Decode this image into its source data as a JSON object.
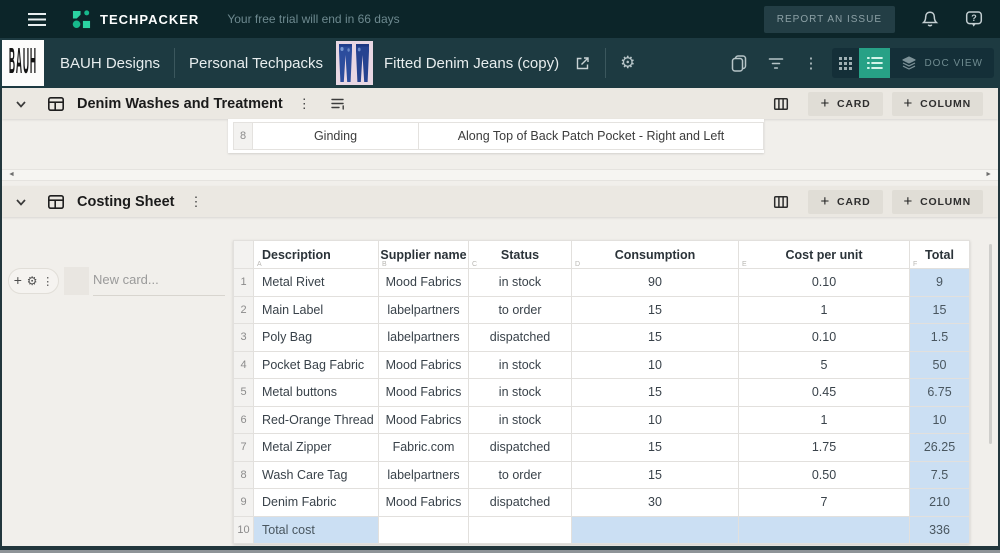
{
  "topbar": {
    "brand": "TECHPACKER",
    "trial_text": "Your free trial will end in 66 days",
    "report_button": "REPORT AN ISSUE"
  },
  "breadcrumb": {
    "logo_text": "BAUH",
    "company": "BAUH Designs",
    "workspace": "Personal Techpacks",
    "techpack_title": "Fitted Denim Jeans (copy)",
    "doc_view_label": "DOC VIEW"
  },
  "section_denim": {
    "title": "Denim Washes and Treatment",
    "card_button": "CARD",
    "column_button": "COLUMN",
    "visible_row": {
      "num": "8",
      "process": "Ginding",
      "placement": "Along Top of Back Patch Pocket - Right and Left"
    }
  },
  "section_costing": {
    "title": "Costing Sheet",
    "card_button": "CARD",
    "column_button": "COLUMN",
    "new_card_placeholder": "New card...",
    "table": {
      "columns": [
        {
          "letter": "A",
          "label": "Description"
        },
        {
          "letter": "B",
          "label": "Supplier name"
        },
        {
          "letter": "C",
          "label": "Status"
        },
        {
          "letter": "D",
          "label": "Consumption"
        },
        {
          "letter": "E",
          "label": "Cost per unit"
        },
        {
          "letter": "F",
          "label": "Total"
        }
      ],
      "rows": [
        {
          "num": "1",
          "cells": [
            "Metal Rivet",
            "Mood Fabrics",
            "in stock",
            "90",
            "0.10",
            "9"
          ]
        },
        {
          "num": "2",
          "cells": [
            "Main Label",
            "labelpartners",
            "to order",
            "15",
            "1",
            "15"
          ]
        },
        {
          "num": "3",
          "cells": [
            "Poly Bag",
            "labelpartners",
            "dispatched",
            "15",
            "0.10",
            "1.5"
          ]
        },
        {
          "num": "4",
          "cells": [
            "Pocket Bag Fabric",
            "Mood Fabrics",
            "in stock",
            "10",
            "5",
            "50"
          ]
        },
        {
          "num": "5",
          "cells": [
            "Metal buttons",
            "Mood Fabrics",
            "in stock",
            "15",
            "0.45",
            "6.75"
          ]
        },
        {
          "num": "6",
          "cells": [
            "Red-Orange Thread",
            "Mood Fabrics",
            "in stock",
            "10",
            "1",
            "10"
          ]
        },
        {
          "num": "7",
          "cells": [
            "Metal Zipper",
            "Fabric.com",
            "dispatched",
            "15",
            "1.75",
            "26.25"
          ]
        },
        {
          "num": "8",
          "cells": [
            "Wash Care Tag",
            "labelpartners",
            "to order",
            "15",
            "0.50",
            "7.5"
          ]
        },
        {
          "num": "9",
          "cells": [
            "Denim Fabric",
            "Mood Fabrics",
            "dispatched",
            "30",
            "7",
            "210"
          ]
        },
        {
          "num": "10",
          "cells": [
            "Total cost",
            "",
            "",
            "",
            "",
            "336"
          ]
        }
      ]
    }
  },
  "colors": {
    "topbar_bg": "#0c2529",
    "toolbar_bg": "#1d3a41",
    "accent_green": "#2bd3a2",
    "active_view_bg": "#27a186",
    "content_bg": "#f1efeb",
    "section_header_bg": "#ebe8e2",
    "highlight_cell": "#cbdff3",
    "button_grey": "#e0ddd6"
  }
}
